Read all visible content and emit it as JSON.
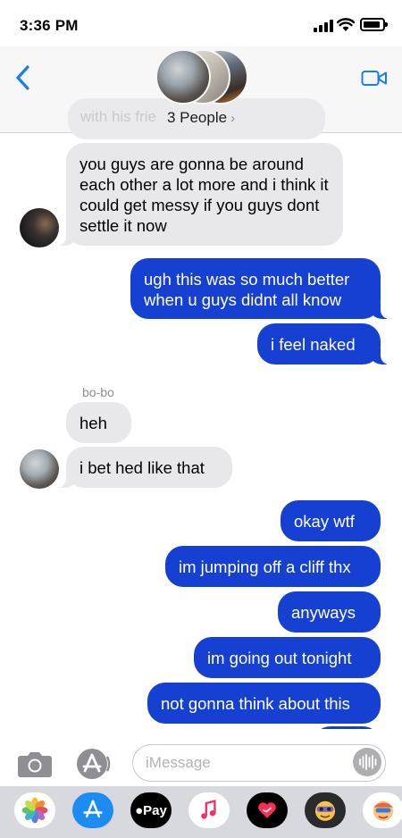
{
  "status_bar": {
    "time": "3:36 PM",
    "icons": [
      "signal-icon",
      "wifi-icon",
      "battery-icon"
    ]
  },
  "header": {
    "title": "3 People",
    "title_chevron": "›",
    "partial_message": "with his frie",
    "icons": [
      "back-chevron-icon",
      "video-call-icon"
    ]
  },
  "conversation": {
    "messages": [
      {
        "direction": "incoming",
        "text": "you guys are gonna be around each other a lot more and i think it could get messy if you guys dont settle it now"
      },
      {
        "direction": "outgoing",
        "text": "ugh this was so much better when u guys didnt all know"
      },
      {
        "direction": "outgoing",
        "text": "i feel naked"
      },
      {
        "direction": "incoming",
        "sender": "bo-bo",
        "text": "heh"
      },
      {
        "direction": "incoming",
        "text": "i bet hed like that"
      },
      {
        "direction": "outgoing",
        "text": "okay wtf"
      },
      {
        "direction": "outgoing",
        "text": "im jumping off a cliff thx"
      },
      {
        "direction": "outgoing",
        "text": "anyways"
      },
      {
        "direction": "outgoing",
        "text": "im going out tonight"
      },
      {
        "direction": "outgoing",
        "text": "not gonna think about this"
      }
    ]
  },
  "composer": {
    "placeholder": "iMessage",
    "value": "",
    "icons": [
      "camera-icon",
      "app-store-icon",
      "audio-message-icon"
    ]
  },
  "app_drawer": {
    "apps": [
      {
        "icon": "photos-icon"
      },
      {
        "icon": "app-store-icon"
      },
      {
        "icon": "apple-pay-icon",
        "label": "Pay"
      },
      {
        "icon": "music-icon"
      },
      {
        "icon": "digital-touch-icon"
      },
      {
        "icon": "memoji-icon"
      },
      {
        "icon": "memoji-stickers-icon"
      }
    ]
  },
  "colors": {
    "outgoing_bubble": "#1640d2",
    "incoming_bubble": "#e8e8eb",
    "accent": "#1d7bf2"
  }
}
